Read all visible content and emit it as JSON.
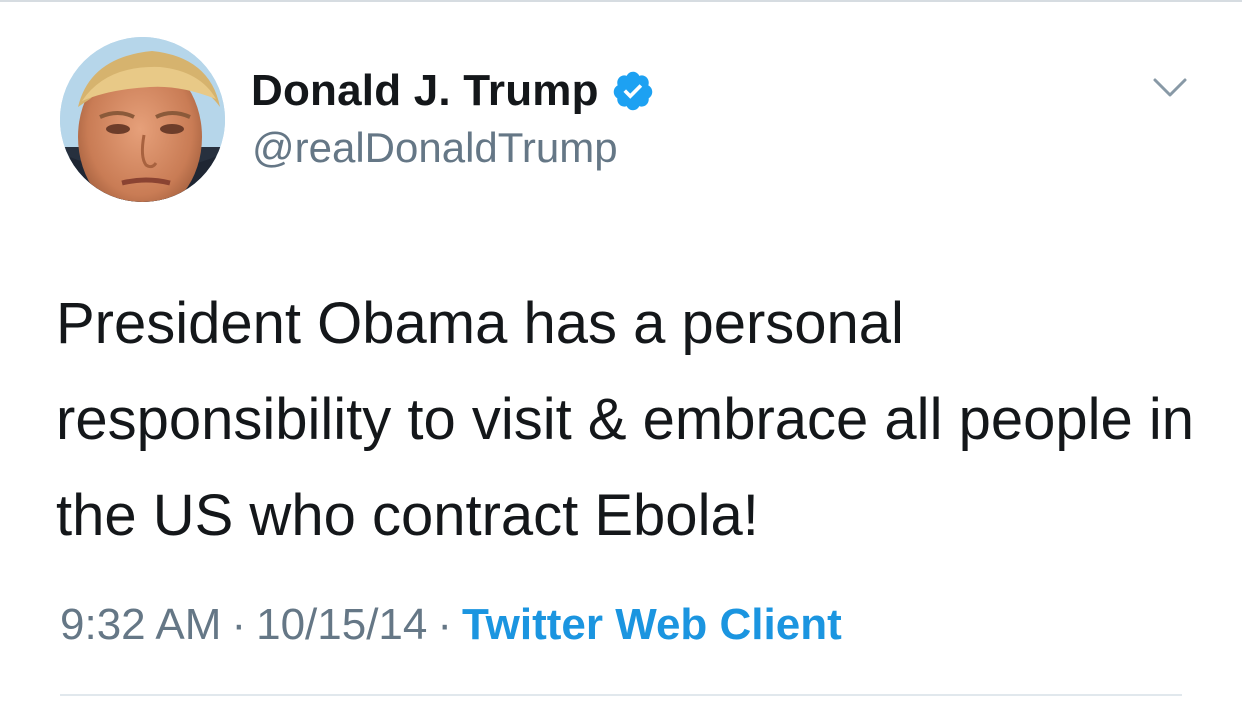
{
  "tweet": {
    "author": {
      "name": "Donald J. Trump",
      "handle": "@realDonaldTrump",
      "verified": true,
      "verified_icon": "verified-badge-icon",
      "avatar_icon": "profile-photo"
    },
    "text": "President Obama has a personal responsibility to visit & embrace all people in the US who contract Ebola!",
    "time": "9:32 AM",
    "separator": "·",
    "date": "10/15/14",
    "source": "Twitter Web Client",
    "menu_icon": "chevron-down-icon"
  },
  "colors": {
    "text_primary": "#14171a",
    "text_secondary": "#657786",
    "link": "#1b95e0",
    "verified": "#1da1f2",
    "divider": "#e1e8ed",
    "background": "#ffffff"
  }
}
